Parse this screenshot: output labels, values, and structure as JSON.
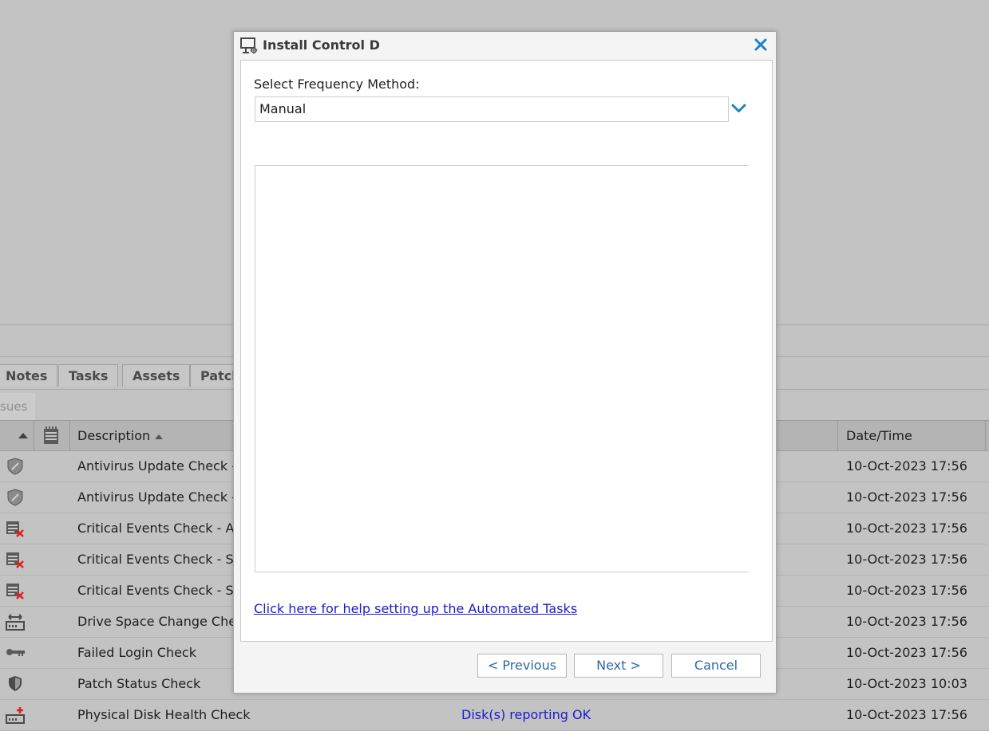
{
  "tabs": [
    "Notes",
    "Tasks",
    "Assets",
    "Patch"
  ],
  "subtab": "sues",
  "grid": {
    "headers": {
      "description": "Description",
      "datetime": "Date/Time"
    },
    "rows": [
      {
        "icon": "shield-icon",
        "description": "Antivirus Update Check - W",
        "status": "",
        "datetime": "10-Oct-2023 17:56"
      },
      {
        "icon": "shield-icon",
        "description": "Antivirus Update Check - W",
        "status": "",
        "datetime": "10-Oct-2023 17:56"
      },
      {
        "icon": "event-log-error-icon",
        "description": "Critical Events Check - App",
        "status": "",
        "datetime": "10-Oct-2023 17:56"
      },
      {
        "icon": "event-log-error-icon",
        "description": "Critical Events Check - Secu",
        "status": "",
        "datetime": "10-Oct-2023 17:56"
      },
      {
        "icon": "event-log-error-icon",
        "description": "Critical Events Check - Syst",
        "status": "",
        "datetime": "10-Oct-2023 17:56"
      },
      {
        "icon": "drive-space-icon",
        "description": "Drive Space Change Check",
        "status": "",
        "datetime": "10-Oct-2023 17:56"
      },
      {
        "icon": "key-icon",
        "description": "Failed Login Check",
        "status": "",
        "datetime": "10-Oct-2023 17:56"
      },
      {
        "icon": "patch-shield-icon",
        "description": "Patch Status Check",
        "status": "",
        "datetime": "10-Oct-2023 10:03"
      },
      {
        "icon": "disk-health-icon",
        "description": "Physical Disk Health Check",
        "status": "Disk(s) reporting OK",
        "datetime": "10-Oct-2023 17:56"
      }
    ]
  },
  "dialog": {
    "title": "Install Control D",
    "frequency_label": "Select Frequency Method:",
    "frequency_value": "Manual",
    "help_link": "Click here for help setting up the Automated Tasks",
    "buttons": {
      "previous": "< Previous",
      "next": "Next >",
      "cancel": "Cancel"
    }
  },
  "colors": {
    "accent": "#1b83c6",
    "link": "#1a1ad0",
    "button_text": "#2b6aa3"
  }
}
